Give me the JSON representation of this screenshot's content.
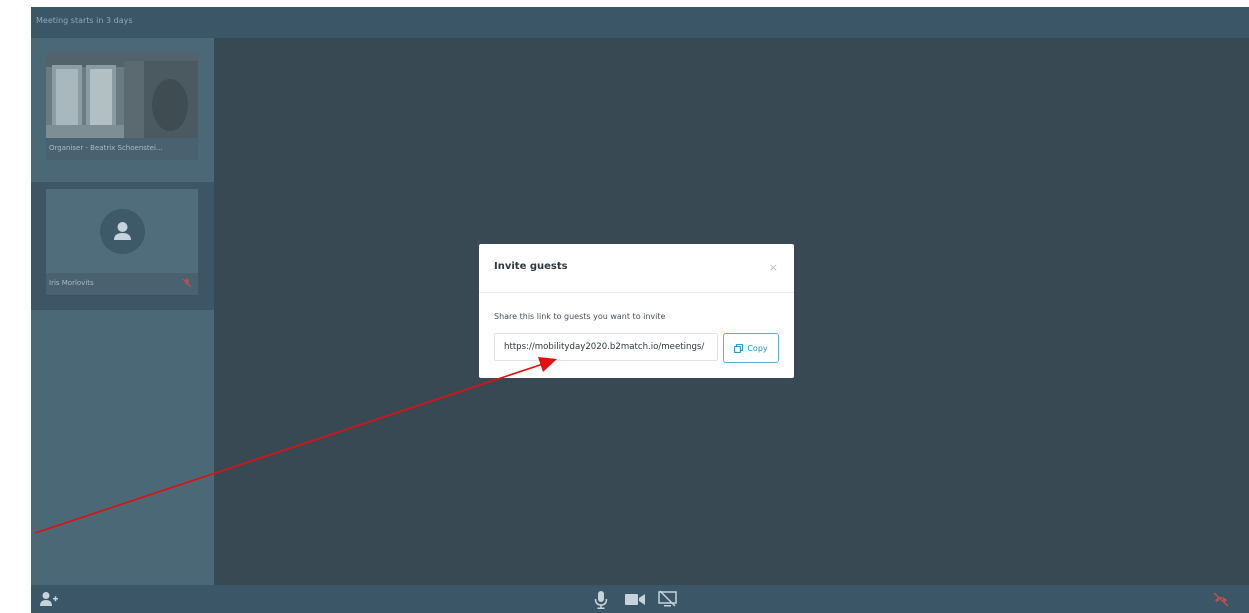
{
  "meeting": {
    "status_text": "Meeting starts in 3 days"
  },
  "participants": [
    {
      "name": "Organiser - Beatrix Schoenstei...",
      "role": "video"
    },
    {
      "name": "Iris Morlovits",
      "role": "avatar",
      "muted": true
    }
  ],
  "invite_modal": {
    "title": "Invite guests",
    "close_label": "×",
    "description": "Share this link to guests you want to invite",
    "link_value": "https://mobilityday2020.b2match.io/meetings/",
    "copy_label": "Copy"
  },
  "controls": {
    "icons": [
      "add-participant-icon",
      "microphone-icon",
      "camera-icon",
      "screen-share-off-icon",
      "hangup-icon"
    ]
  },
  "colors": {
    "background": "#384954",
    "bar": "#3b5666",
    "sidebar": "#4b6877",
    "accent": "#1e8fc6",
    "hangup": "#c0504d",
    "annotation_arrow": "#e01010"
  }
}
